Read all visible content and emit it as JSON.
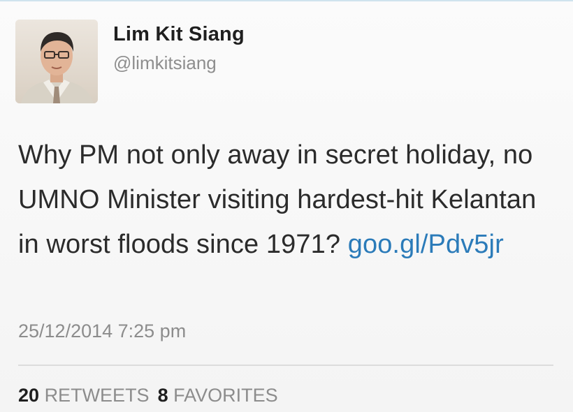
{
  "tweet": {
    "author": {
      "display_name": "Lim Kit Siang",
      "handle": "@limkitsiang"
    },
    "text_before_link": "Why PM not only away in secret holiday, no UMNO Minister visiting hardest-hit Kelantan in worst floods since 1971? ",
    "link_text": "goo.gl/Pdv5jr",
    "timestamp": "25/12/2014 7:25 pm",
    "stats": {
      "retweets_count": "20",
      "retweets_label": "RETWEETS",
      "favorites_count": "8",
      "favorites_label": "FAVORITES"
    }
  },
  "colors": {
    "link": "#2b7bb9",
    "muted_text": "#8c8c8c",
    "primary_text": "#2b2b2b"
  },
  "icons": {
    "avatar": "user-photo"
  }
}
